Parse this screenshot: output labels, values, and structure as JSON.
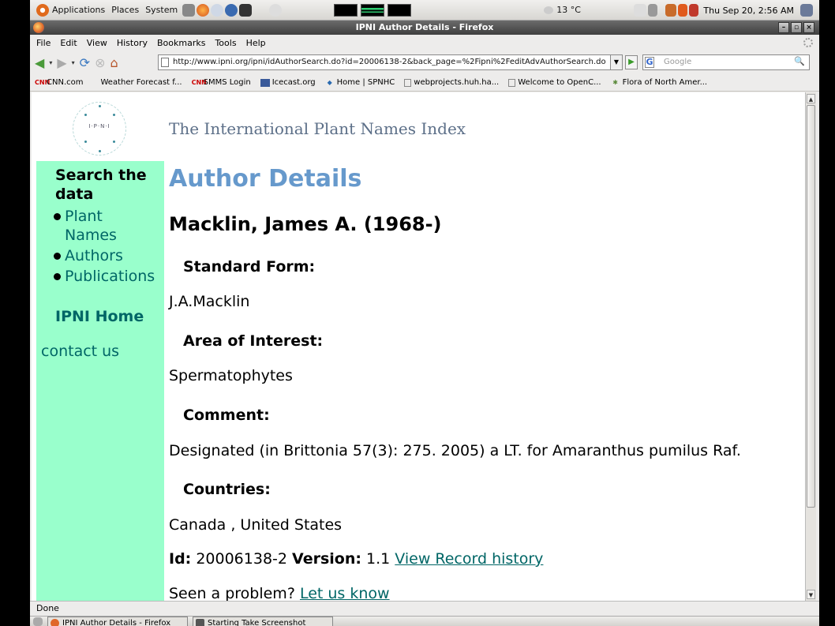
{
  "panel": {
    "applications": "Applications",
    "places": "Places",
    "system": "System",
    "weather": "13 °C",
    "clock": "Thu Sep 20,  2:56 AM"
  },
  "window": {
    "title": "IPNI Author Details - Firefox"
  },
  "menubar": [
    "File",
    "Edit",
    "View",
    "History",
    "Bookmarks",
    "Tools",
    "Help"
  ],
  "toolbar": {
    "url": "http://www.ipni.org/ipni/idAuthorSearch.do?id=20006138-2&back_page=%2Fipni%2FeditAdvAuthorSearch.do",
    "search_placeholder": "Google"
  },
  "bookmarks": [
    "CNN.com",
    "Weather Forecast f...",
    "SMMS Login",
    "Icecast.org",
    "Home | SPNHC",
    "webprojects.huh.ha...",
    "Welcome to OpenC...",
    "Flora of North Amer..."
  ],
  "site": {
    "logo_text": "I·P·N·I",
    "title": "The International Plant Names Index"
  },
  "sidebar": {
    "heading": "Search the data",
    "items": [
      "Plant Names",
      "Authors",
      "Publications"
    ],
    "home": "IPNI Home",
    "contact": "contact us"
  },
  "details": {
    "page_heading": "Author Details",
    "name": "Macklin, James A. (1968-)",
    "standard_form_label": "Standard Form:",
    "standard_form": "J.A.Macklin",
    "interest_label": "Area of Interest:",
    "interest": "Spermatophytes",
    "comment_label": "Comment:",
    "comment": "Designated (in Brittonia 57(3): 275. 2005) a LT. for Amaranthus pumilus Raf.",
    "countries_label": "Countries:",
    "countries": "Canada , United States",
    "id_label": "Id:",
    "id": "20006138-2",
    "version_label": "Version:",
    "version": "1.1",
    "history_link": "View Record history",
    "problem_text": "Seen a problem?",
    "problem_link": "Let us know"
  },
  "status": "Done",
  "taskbar": [
    "IPNI Author Details - Firefox",
    "Starting Take Screenshot"
  ]
}
